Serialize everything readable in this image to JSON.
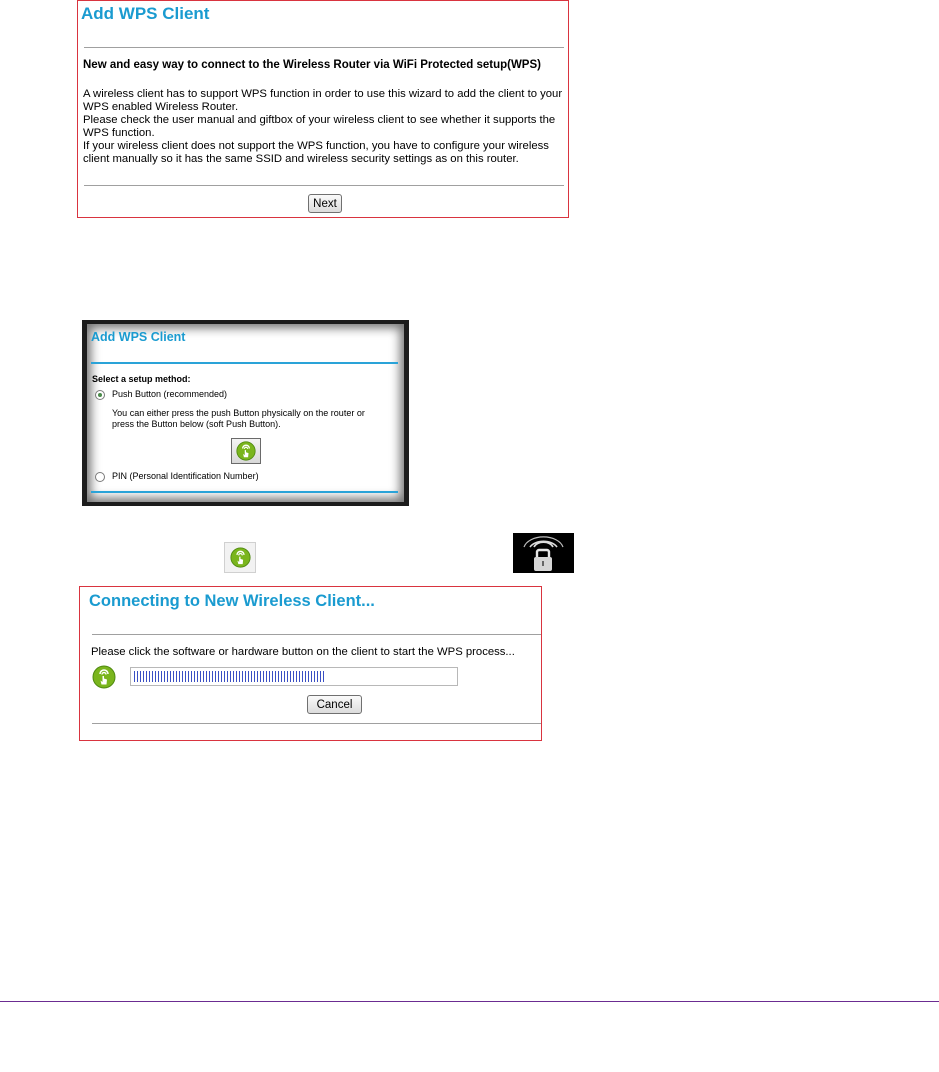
{
  "add_wps_panel": {
    "title": "Add WPS Client",
    "heading": "New and easy way to connect to the Wireless Router via WiFi Protected setup(WPS)",
    "paragraphs": [
      "A wireless client has to support WPS function in order to use this wizard to add the client to your WPS enabled Wireless Router.",
      "Please check the user manual and giftbox of your wireless client to see whether it supports the WPS function.",
      "If your wireless client does not support the WPS function, you have to configure your wireless client manually so it has the same SSID and wireless security settings as on this router."
    ],
    "next_label": "Next"
  },
  "setup_method_panel": {
    "title": "Add WPS Client",
    "prompt": "Select a setup method:",
    "options": [
      {
        "label": "Push Button (recommended)",
        "selected": true
      },
      {
        "label": "PIN (Personal Identification Number)",
        "selected": false
      }
    ],
    "push_desc_line1": "You can either press the push Button physically on the router or",
    "push_desc_line2": "press the Button below (soft Push Button)."
  },
  "inline_icons": {
    "wps_button_icon": "wps-push-button-icon",
    "lock_icon": "wireless-lock-icon"
  },
  "connecting_panel": {
    "title": "Connecting to New Wireless Client...",
    "message": "Please click the software or hardware button on the client to start the WPS process...",
    "progress": 0.6,
    "cancel_label": "Cancel"
  },
  "colors": {
    "title_blue": "#1a9bd0",
    "panel_border_red": "#d9343f",
    "progress_blue": "#3a4fc4",
    "footer_rule_purple": "#6b2c91",
    "wps_icon_green": "#7ab51d"
  }
}
